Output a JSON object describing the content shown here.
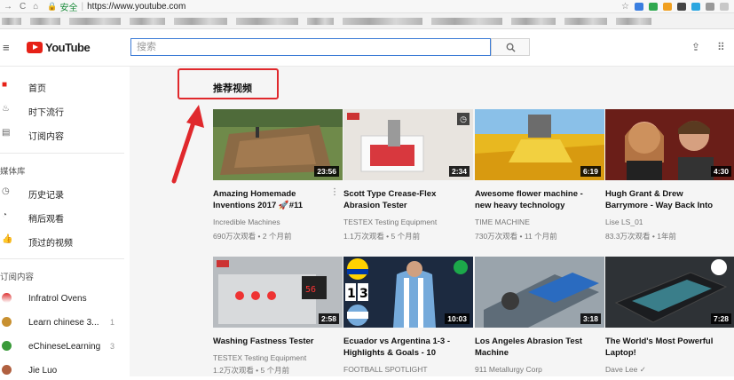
{
  "browser": {
    "url": "https://www.youtube.com",
    "secure_label": "安全"
  },
  "header": {
    "logo_text": "YouTube",
    "search_placeholder": "搜索"
  },
  "sidebar": {
    "items": [
      {
        "label": "首页",
        "icon": "home-icon"
      },
      {
        "label": "时下流行",
        "icon": "flame-icon"
      },
      {
        "label": "订阅内容",
        "icon": "subscriptions-icon"
      }
    ],
    "library_heading": "媒体库",
    "library": [
      {
        "label": "历史记录",
        "icon": "history-icon"
      },
      {
        "label": "稍后观看",
        "icon": "clock-icon"
      },
      {
        "label": "顶过的视频",
        "icon": "thumb-up-icon"
      }
    ],
    "subscriptions_heading": "订阅内容",
    "subscriptions": [
      {
        "label": "Infratrol Ovens",
        "count": ""
      },
      {
        "label": "Learn chinese 3...",
        "count": "1"
      },
      {
        "label": "eChineseLearning",
        "count": "3"
      },
      {
        "label": "Jie Luo",
        "count": ""
      }
    ]
  },
  "main": {
    "section_title": "推荐视频",
    "videos": [
      {
        "title1": "Amazing Homemade",
        "title2": "Inventions 2017 🚀#11",
        "channel": "Incredible Machines",
        "meta": "690万次观看 • 2 个月前",
        "duration": "23:56"
      },
      {
        "title1": "Scott Type Crease-Flex",
        "title2": "Abrasion Tester",
        "channel": "TESTEX Testing Equipment",
        "meta": "1.1万次观看 • 5 个月前",
        "duration": "2:34"
      },
      {
        "title1": "Awesome flower machine -",
        "title2": "new heavy technology",
        "channel": "TIME MACHINE",
        "meta": "730万次观看 • 11 个月前",
        "duration": "6:19"
      },
      {
        "title1": "Hugh Grant & Drew",
        "title2": "Barrymore - Way Back Into",
        "channel": "Lise LS_01",
        "meta": "83.3万次观看 • 1年前",
        "duration": "4:30"
      },
      {
        "title1": "Washing Fastness Tester",
        "title2": "",
        "channel": "TESTEX Testing Equipment",
        "meta": "1.2万次观看 • 5 个月前",
        "duration": "2:58"
      },
      {
        "title1": "Ecuador vs Argentina 1-3 -",
        "title2": "Highlights & Goals - 10",
        "channel": "FOOTBALL SPOTLIGHT",
        "meta": "",
        "duration": "10:03"
      },
      {
        "title1": "Los Angeles Abrasion Test",
        "title2": "Machine",
        "channel": "911 Metallurgy Corp",
        "meta": "",
        "duration": "3:18"
      },
      {
        "title1": "The World's Most Powerful",
        "title2": "Laptop!",
        "channel": "Dave Lee ✓",
        "meta": "",
        "duration": "7:28"
      }
    ]
  },
  "colors": {
    "accent": "#e62117",
    "annotation": "#e0282c",
    "search_border": "#3b7bd6"
  }
}
